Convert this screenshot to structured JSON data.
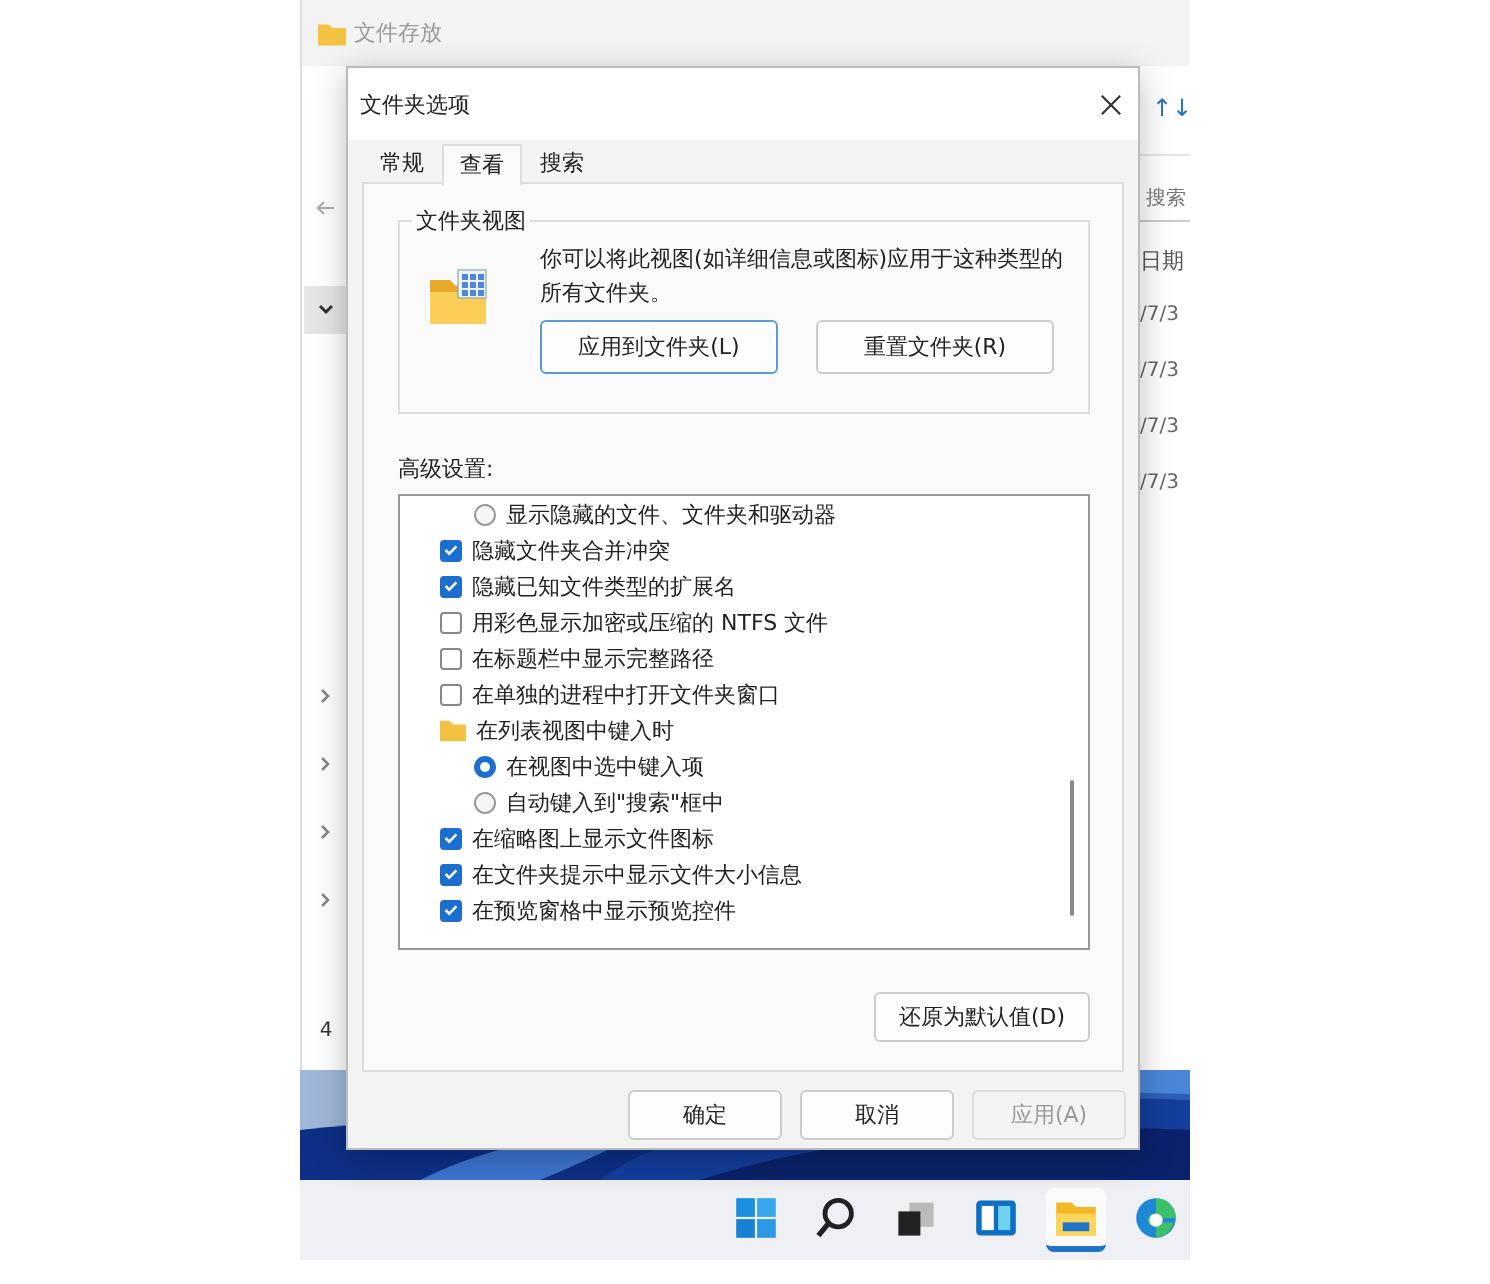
{
  "explorer": {
    "title": "文件存放",
    "sort_glyph": "↑↓",
    "search": {
      "placeholder": "搜索"
    },
    "column_header": "日期",
    "dates": [
      "/7/3",
      "/7/3",
      "/7/3",
      "/7/3"
    ],
    "item_count": "4"
  },
  "dialog": {
    "title": "文件夹选项",
    "tabs": [
      {
        "label": "常规",
        "selected": false
      },
      {
        "label": "查看",
        "selected": true
      },
      {
        "label": "搜索",
        "selected": false
      }
    ],
    "folder_views": {
      "title": "文件夹视图",
      "description": "你可以将此视图(如详细信息或图标)应用于这种类型的所有文件夹。",
      "buttons": [
        {
          "label": "应用到文件夹(L)",
          "focused": true
        },
        {
          "label": "重置文件夹(R)",
          "focused": false
        }
      ]
    },
    "advanced_label": "高级设置:",
    "settings": [
      {
        "kind": "radio",
        "label": "显示隐藏的文件、文件夹和驱动器",
        "selected": false
      },
      {
        "kind": "checkbox",
        "label": "隐藏文件夹合并冲突",
        "checked": true
      },
      {
        "kind": "checkbox",
        "label": "隐藏已知文件类型的扩展名",
        "checked": true
      },
      {
        "kind": "checkbox",
        "label": "用彩色显示加密或压缩的 NTFS 文件",
        "checked": false
      },
      {
        "kind": "checkbox",
        "label": "在标题栏中显示完整路径",
        "checked": false
      },
      {
        "kind": "checkbox",
        "label": "在单独的进程中打开文件夹窗口",
        "checked": false
      },
      {
        "kind": "folder",
        "label": "在列表视图中键入时",
        "children": [
          {
            "kind": "radio",
            "label": "在视图中选中键入项",
            "selected": true
          },
          {
            "kind": "radio",
            "label": "自动键入到\"搜索\"框中",
            "selected": false
          }
        ]
      },
      {
        "kind": "checkbox",
        "label": "在缩略图上显示文件图标",
        "checked": true
      },
      {
        "kind": "checkbox",
        "label": "在文件夹提示中显示文件大小信息",
        "checked": true
      },
      {
        "kind": "checkbox",
        "label": "在预览窗格中显示预览控件",
        "checked": true
      }
    ],
    "restore_button": "还原为默认值(D)",
    "buttons": [
      {
        "label": "确定",
        "disabled": false
      },
      {
        "label": "取消",
        "disabled": false
      },
      {
        "label": "应用(A)",
        "disabled": true
      }
    ]
  },
  "taskbar": {
    "items": [
      {
        "kind": "start",
        "selected": false
      },
      {
        "kind": "search",
        "selected": false
      },
      {
        "kind": "task-view",
        "selected": false
      },
      {
        "kind": "widgets",
        "selected": false
      },
      {
        "kind": "explorer",
        "selected": true
      },
      {
        "kind": "browser",
        "selected": false
      }
    ]
  }
}
